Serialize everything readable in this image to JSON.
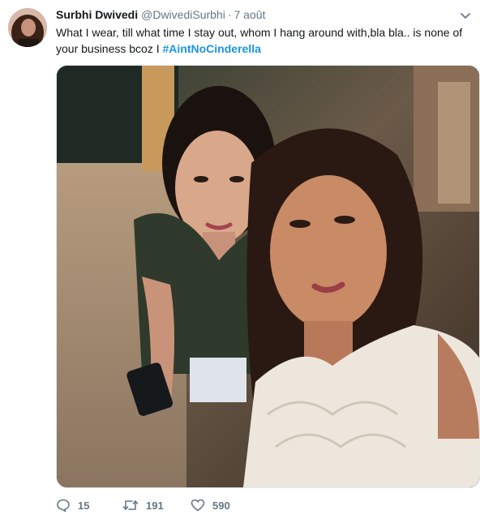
{
  "tweet": {
    "author_name": "Surbhi Dwivedi",
    "author_handle": "@DwivediSurbhi",
    "separator": "·",
    "date": "7 août",
    "text_main": "What I wear, till what time I stay out, whom I hang around with,bla bla.. is none of your business bcoz I ",
    "hashtag": "#AintNoCinderella"
  },
  "actions": {
    "reply_count": "15",
    "retweet_count": "191",
    "like_count": "590"
  },
  "icons": {
    "caret": "chevron-down-icon",
    "reply": "reply-icon",
    "retweet": "retweet-icon",
    "like": "heart-icon"
  },
  "colors": {
    "link": "#1b95e0",
    "muted": "#657786",
    "text": "#14171a"
  }
}
